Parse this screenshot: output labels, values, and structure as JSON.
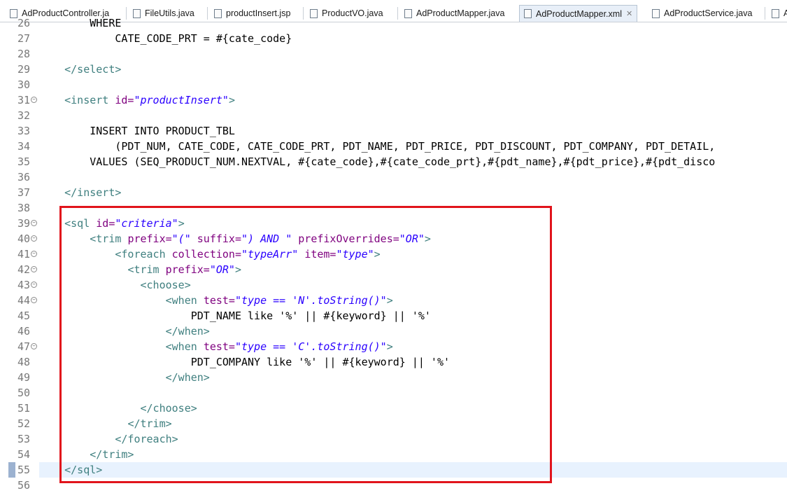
{
  "tabs": [
    {
      "label": "AdProductController.ja",
      "icon": "java-file-icon"
    },
    {
      "label": "FileUtils.java",
      "icon": "java-file-icon"
    },
    {
      "label": "productInsert.jsp",
      "icon": "jsp-file-icon"
    },
    {
      "label": "ProductVO.java",
      "icon": "java-file-icon"
    },
    {
      "label": "AdProductMapper.java",
      "icon": "java-file-icon"
    },
    {
      "label": "AdProductMapper.xml",
      "icon": "xml-file-icon",
      "active": true
    },
    {
      "label": "AdProductService.java",
      "icon": "java-file-icon"
    },
    {
      "label": "A",
      "icon": "java-file-icon"
    }
  ],
  "tab_close_glyph": "✕",
  "highlight_color": "#e1141c",
  "lines": [
    {
      "n": "26",
      "fold": false,
      "segs": [
        [
          "p",
          "        WHERE"
        ]
      ]
    },
    {
      "n": "27",
      "fold": false,
      "segs": [
        [
          "p",
          "            CATE_CODE_PRT = #{cate_code}"
        ]
      ]
    },
    {
      "n": "28",
      "fold": false,
      "segs": []
    },
    {
      "n": "29",
      "fold": false,
      "segs": [
        [
          "p",
          "    "
        ],
        [
          "t",
          "</select>"
        ]
      ]
    },
    {
      "n": "30",
      "fold": false,
      "segs": []
    },
    {
      "n": "31",
      "fold": true,
      "segs": [
        [
          "p",
          "    "
        ],
        [
          "t",
          "<insert "
        ],
        [
          "a",
          "id="
        ],
        [
          "v",
          "\"productInsert\""
        ],
        [
          "t",
          ">"
        ]
      ]
    },
    {
      "n": "32",
      "fold": false,
      "segs": []
    },
    {
      "n": "33",
      "fold": false,
      "segs": [
        [
          "p",
          "        INSERT INTO PRODUCT_TBL"
        ]
      ]
    },
    {
      "n": "34",
      "fold": false,
      "segs": [
        [
          "p",
          "            (PDT_NUM, CATE_CODE, CATE_CODE_PRT, PDT_NAME, PDT_PRICE, PDT_DISCOUNT, PDT_COMPANY, PDT_DETAIL,"
        ]
      ]
    },
    {
      "n": "35",
      "fold": false,
      "segs": [
        [
          "p",
          "        VALUES (SEQ_PRODUCT_NUM.NEXTVAL, #{cate_code},#{cate_code_prt},#{pdt_name},#{pdt_price},#{pdt_disco"
        ]
      ]
    },
    {
      "n": "36",
      "fold": false,
      "segs": []
    },
    {
      "n": "37",
      "fold": false,
      "segs": [
        [
          "p",
          "    "
        ],
        [
          "t",
          "</insert>"
        ]
      ]
    },
    {
      "n": "38",
      "fold": false,
      "segs": []
    },
    {
      "n": "39",
      "fold": true,
      "segs": [
        [
          "p",
          "    "
        ],
        [
          "t",
          "<sql "
        ],
        [
          "a",
          "id="
        ],
        [
          "v",
          "\"criteria\""
        ],
        [
          "t",
          ">"
        ]
      ]
    },
    {
      "n": "40",
      "fold": true,
      "segs": [
        [
          "p",
          "        "
        ],
        [
          "t",
          "<trim "
        ],
        [
          "a",
          "prefix="
        ],
        [
          "v",
          "\"(\""
        ],
        [
          "p",
          " "
        ],
        [
          "a",
          "suffix="
        ],
        [
          "v",
          "\") AND \""
        ],
        [
          "p",
          " "
        ],
        [
          "a",
          "prefixOverrides="
        ],
        [
          "v",
          "\"OR\""
        ],
        [
          "t",
          ">"
        ]
      ]
    },
    {
      "n": "41",
      "fold": true,
      "segs": [
        [
          "p",
          "            "
        ],
        [
          "t",
          "<foreach "
        ],
        [
          "a",
          "collection="
        ],
        [
          "v",
          "\"typeArr\""
        ],
        [
          "p",
          " "
        ],
        [
          "a",
          "item="
        ],
        [
          "v",
          "\"type\""
        ],
        [
          "t",
          ">"
        ]
      ]
    },
    {
      "n": "42",
      "fold": true,
      "segs": [
        [
          "p",
          "              "
        ],
        [
          "t",
          "<trim "
        ],
        [
          "a",
          "prefix="
        ],
        [
          "v",
          "\"OR\""
        ],
        [
          "t",
          ">"
        ]
      ]
    },
    {
      "n": "43",
      "fold": true,
      "segs": [
        [
          "p",
          "                "
        ],
        [
          "t",
          "<choose>"
        ]
      ]
    },
    {
      "n": "44",
      "fold": true,
      "segs": [
        [
          "p",
          "                    "
        ],
        [
          "t",
          "<when "
        ],
        [
          "a",
          "test="
        ],
        [
          "v",
          "\"type == 'N'.toString()\""
        ],
        [
          "t",
          ">"
        ]
      ]
    },
    {
      "n": "45",
      "fold": false,
      "segs": [
        [
          "p",
          "                        PDT_NAME like '%' || #{keyword} || '%'"
        ]
      ]
    },
    {
      "n": "46",
      "fold": false,
      "segs": [
        [
          "p",
          "                    "
        ],
        [
          "t",
          "</when>"
        ]
      ]
    },
    {
      "n": "47",
      "fold": true,
      "segs": [
        [
          "p",
          "                    "
        ],
        [
          "t",
          "<when "
        ],
        [
          "a",
          "test="
        ],
        [
          "v",
          "\"type == 'C'.toString()\""
        ],
        [
          "t",
          ">"
        ]
      ]
    },
    {
      "n": "48",
      "fold": false,
      "segs": [
        [
          "p",
          "                        PDT_COMPANY like '%' || #{keyword} || '%'"
        ]
      ]
    },
    {
      "n": "49",
      "fold": false,
      "segs": [
        [
          "p",
          "                    "
        ],
        [
          "t",
          "</when>"
        ]
      ]
    },
    {
      "n": "50",
      "fold": false,
      "segs": []
    },
    {
      "n": "51",
      "fold": false,
      "segs": [
        [
          "p",
          "                "
        ],
        [
          "t",
          "</choose>"
        ]
      ]
    },
    {
      "n": "52",
      "fold": false,
      "segs": [
        [
          "p",
          "              "
        ],
        [
          "t",
          "</trim>"
        ]
      ]
    },
    {
      "n": "53",
      "fold": false,
      "segs": [
        [
          "p",
          "            "
        ],
        [
          "t",
          "</foreach>"
        ]
      ]
    },
    {
      "n": "54",
      "fold": false,
      "segs": [
        [
          "p",
          "        "
        ],
        [
          "t",
          "</trim>"
        ]
      ]
    },
    {
      "n": "55",
      "fold": false,
      "current": true,
      "segs": [
        [
          "p",
          "    "
        ],
        [
          "t",
          "</sql>"
        ]
      ]
    },
    {
      "n": "56",
      "fold": false,
      "segs": []
    }
  ]
}
